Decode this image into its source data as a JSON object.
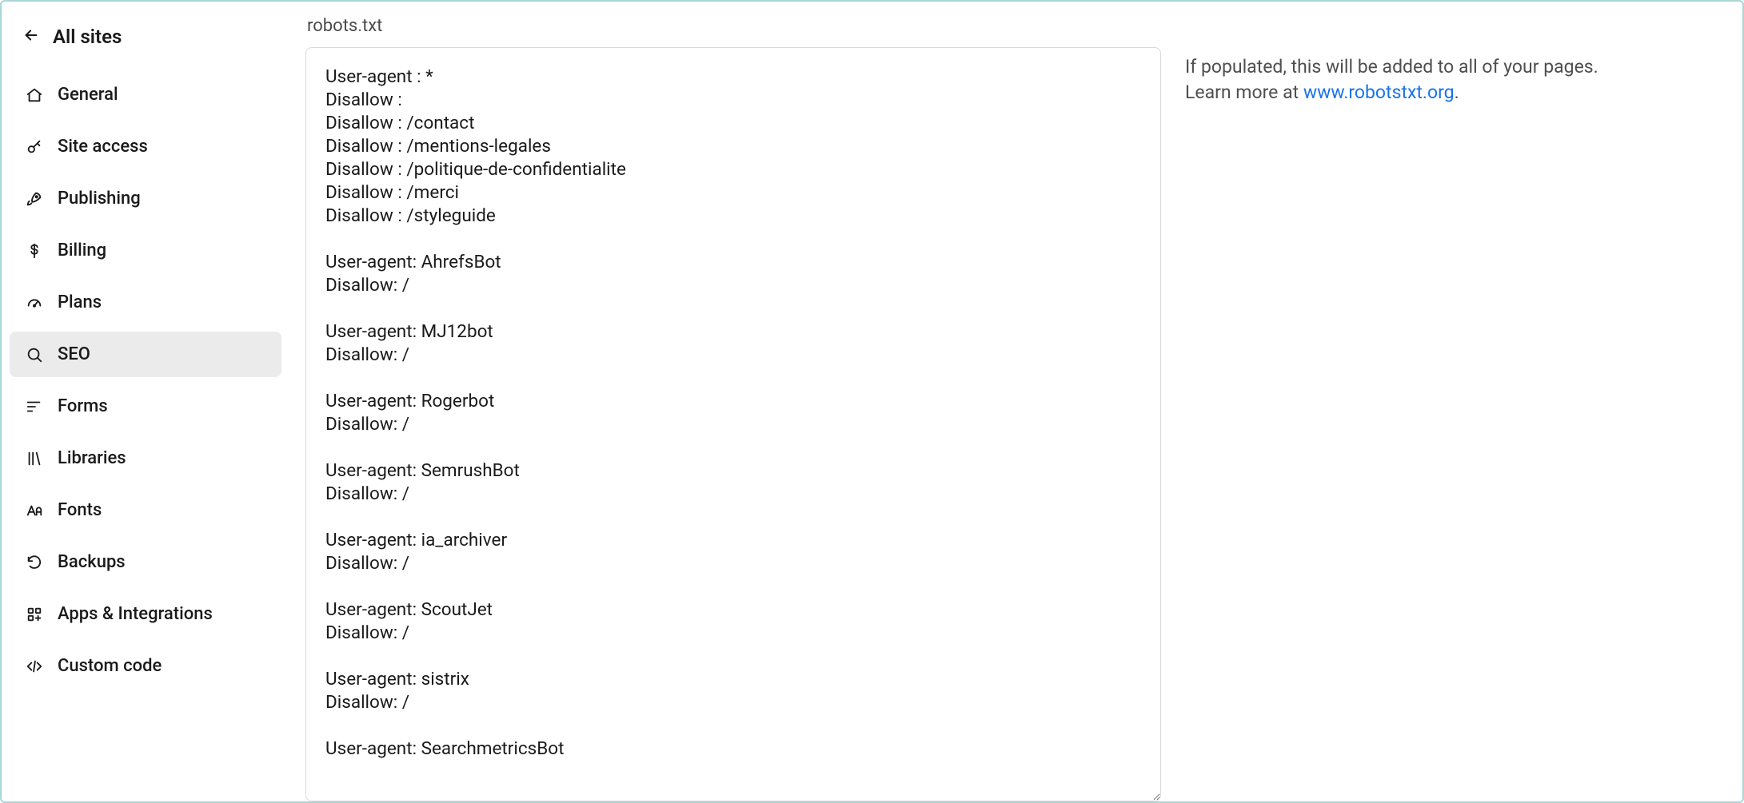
{
  "back": {
    "label": "All sites"
  },
  "sidebar": {
    "items": [
      {
        "id": "general",
        "label": "General",
        "icon": "home-icon"
      },
      {
        "id": "access",
        "label": "Site access",
        "icon": "key-icon"
      },
      {
        "id": "publish",
        "label": "Publishing",
        "icon": "rocket-icon"
      },
      {
        "id": "billing",
        "label": "Billing",
        "icon": "dollar-icon"
      },
      {
        "id": "plans",
        "label": "Plans",
        "icon": "gauge-icon"
      },
      {
        "id": "seo",
        "label": "SEO",
        "icon": "search-icon",
        "active": true
      },
      {
        "id": "forms",
        "label": "Forms",
        "icon": "bars-icon"
      },
      {
        "id": "libs",
        "label": "Libraries",
        "icon": "libraries-icon"
      },
      {
        "id": "fonts",
        "label": "Fonts",
        "icon": "fonts-icon"
      },
      {
        "id": "backups",
        "label": "Backups",
        "icon": "undo-icon"
      },
      {
        "id": "apps",
        "label": "Apps & Integrations",
        "icon": "apps-icon"
      },
      {
        "id": "code",
        "label": "Custom code",
        "icon": "code-icon"
      }
    ]
  },
  "main": {
    "field_label": "robots.txt",
    "robots_value": "User-agent : *\nDisallow :\nDisallow : /contact\nDisallow : /mentions-legales\nDisallow : /politique-de-confidentialite\nDisallow : /merci\nDisallow : /styleguide\n\nUser-agent: AhrefsBot\nDisallow: /\n\nUser-agent: MJ12bot\nDisallow: /\n\nUser-agent: Rogerbot\nDisallow: /\n\nUser-agent: SemrushBot\nDisallow: /\n\nUser-agent: ia_archiver\nDisallow: /\n\nUser-agent: ScoutJet\nDisallow: /\n\nUser-agent: sistrix\nDisallow: /\n\nUser-agent: SearchmetricsBot",
    "help_prefix": "If populated, this will be added to all of your pages. Learn more at ",
    "help_link_text": "www.robotstxt.org",
    "help_suffix": "."
  }
}
